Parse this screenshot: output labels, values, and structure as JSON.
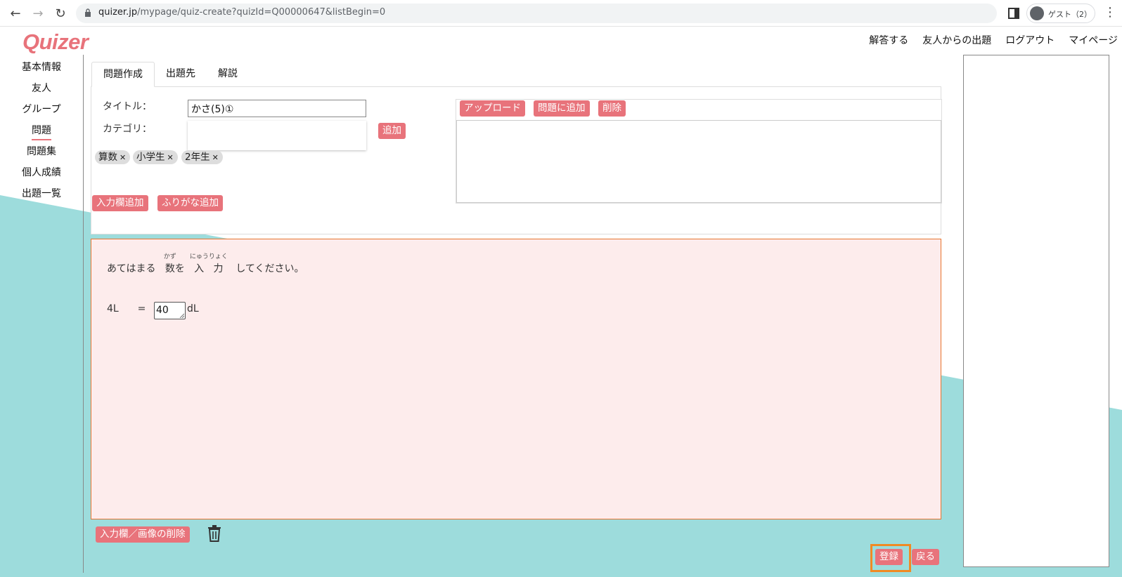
{
  "browser": {
    "url_host": "quizer.jp",
    "url_path": "/mypage/quiz-create?quizId=Q00000647&listBegin=0",
    "profile_name": "ゲスト（2）"
  },
  "header": {
    "logo": "Quizer",
    "nav": [
      "解答する",
      "友人からの出題",
      "ログアウト",
      "マイページ"
    ]
  },
  "sidebar": {
    "items": [
      {
        "label": "基本情報",
        "active": false
      },
      {
        "label": "友人",
        "active": false
      },
      {
        "label": "グループ",
        "active": false
      },
      {
        "label": "問題",
        "active": true
      },
      {
        "label": "問題集",
        "active": false
      },
      {
        "label": "個人成績",
        "active": false
      },
      {
        "label": "出題一覧",
        "active": false
      }
    ]
  },
  "tabs": [
    {
      "label": "問題作成",
      "active": true
    },
    {
      "label": "出題先",
      "active": false
    },
    {
      "label": "解説",
      "active": false
    }
  ],
  "form": {
    "title_label": "タイトル：",
    "title_value": "かさ(5)①",
    "category_label": "カテゴリ：",
    "add_button": "追加",
    "tags": [
      "算数",
      "小学生",
      "2年生"
    ],
    "add_field_button": "入力欄追加",
    "add_furigana_button": "ふりがな追加"
  },
  "upload": {
    "upload_button": "アップロード",
    "add_to_question_button": "問題に追加",
    "delete_button": "削除"
  },
  "question": {
    "text_1": "あてはまる",
    "word_kazu": "数",
    "ruby_kazu": "かず",
    "text_2": "を",
    "word_nyu": "入",
    "word_ryoku": "力",
    "ruby_nyuryoku": "にゅうりょく",
    "text_3": "してください。",
    "lhs": "4L",
    "equals": "=",
    "answer_value": "40",
    "unit": "dL"
  },
  "footer": {
    "delete_field_button": "入力欄／画像の削除",
    "register_button": "登録",
    "back_button": "戻る"
  },
  "colors": {
    "brand": "#e8737b",
    "background_teal": "#9ddcdc",
    "question_bg": "#fdecec",
    "question_border": "#e8742e",
    "highlight": "#f08a24"
  }
}
